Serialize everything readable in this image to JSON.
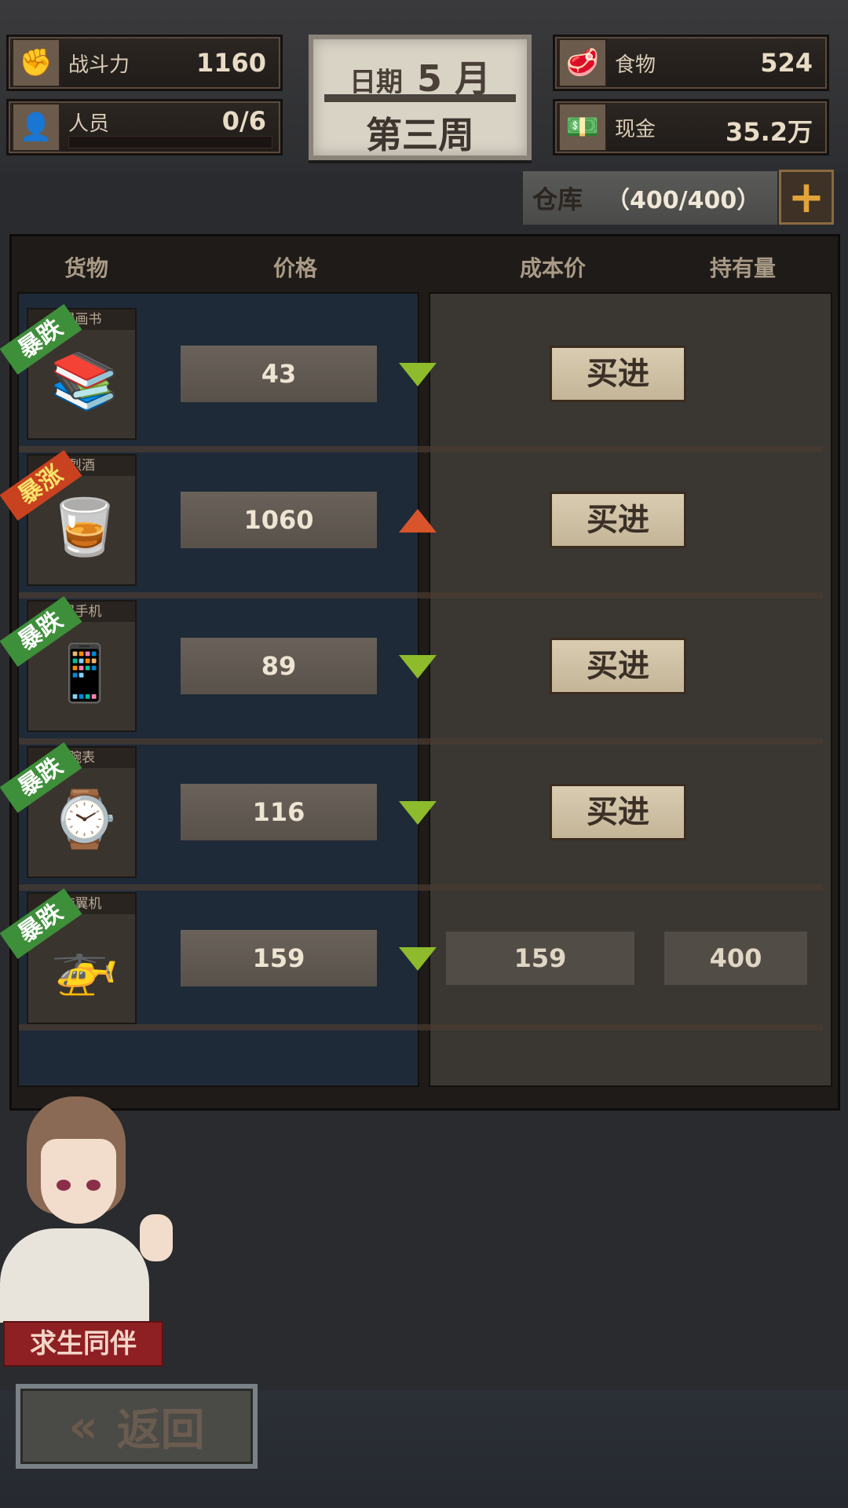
{
  "stats": {
    "power": {
      "label": "战斗力",
      "value": "1160",
      "icon": "fist-icon"
    },
    "staff": {
      "label": "人员",
      "value": "0/6",
      "icon": "person-icon"
    },
    "food": {
      "label": "食物",
      "value": "524",
      "icon": "meat-icon"
    },
    "cash": {
      "label": "现金",
      "value": "35.2万",
      "icon": "money-icon"
    }
  },
  "date": {
    "label": "日期",
    "month": "5 月",
    "week": "第三周"
  },
  "warehouse": {
    "label": "仓库",
    "count": "（400/400）",
    "add": "+"
  },
  "columns": {
    "goods": "货物",
    "price": "价格",
    "cost": "成本价",
    "hold": "持有量"
  },
  "items": [
    {
      "name": "漫画书",
      "tag": "暴跌",
      "trend": "down",
      "price": "43",
      "action": "买进",
      "icon": "📚"
    },
    {
      "name": "烈酒",
      "tag": "暴涨",
      "trend": "up",
      "price": "1060",
      "action": "买进",
      "icon": "🥃"
    },
    {
      "name": "强手机",
      "tag": "暴跌",
      "trend": "down",
      "price": "89",
      "action": "买进",
      "icon": "📱"
    },
    {
      "name": "腕表",
      "tag": "暴跌",
      "trend": "down",
      "price": "116",
      "action": "买进",
      "icon": "⌚"
    },
    {
      "name": "旋翼机",
      "tag": "暴跌",
      "trend": "down",
      "price": "159",
      "cost": "159",
      "hold": "400",
      "icon": "🚁"
    }
  ],
  "companion": {
    "label": "求生同伴"
  },
  "back": {
    "label": "返回",
    "chevron": "«"
  }
}
